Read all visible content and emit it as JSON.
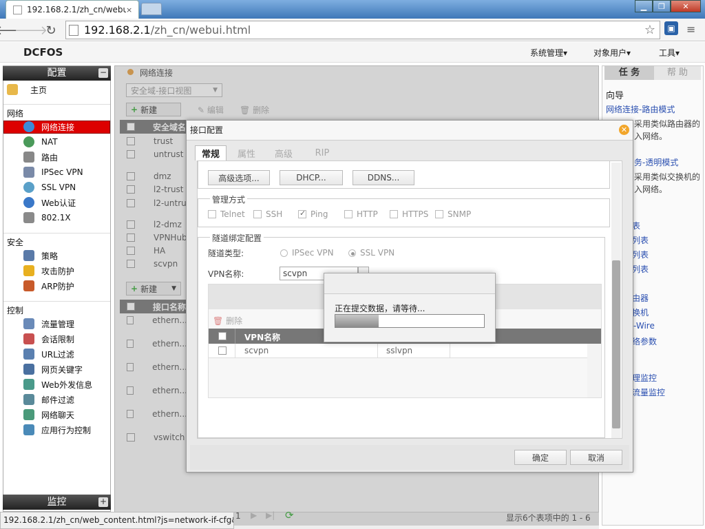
{
  "browser": {
    "tab_title": "192.168.2.1/zh_cn/webu",
    "tab_close": "×",
    "url_host": "192.168.2.1",
    "url_path": "/zh_cn/webui.html",
    "status_url": "192.168.2.1/zh_cn/web_content.html?js=network-if-cfg&..."
  },
  "app": {
    "logo": "DCFOS",
    "top_menu": [
      "系统管理▾",
      "对象用户▾",
      "工具▾"
    ]
  },
  "sidebar": {
    "header": "配置",
    "footer": "监控",
    "toggle_minus": "−",
    "toggle_plus": "+",
    "home": "主页",
    "sections": [
      {
        "title": "网络",
        "items": [
          "网络连接",
          "NAT",
          "路由",
          "IPSec VPN",
          "SSL VPN",
          "Web认证",
          "802.1X"
        ]
      },
      {
        "title": "安全",
        "items": [
          "策略",
          "攻击防护",
          "ARP防护"
        ]
      },
      {
        "title": "控制",
        "items": [
          "流量管理",
          "会话限制",
          "URL过滤",
          "网页关键字",
          "Web外发信息",
          "邮件过滤",
          "网络聊天",
          "应用行为控制"
        ]
      }
    ],
    "selected": "网络连接"
  },
  "main": {
    "breadcrumb": "网络连接",
    "view_select": "安全域-接口视图",
    "new_label": "新建",
    "edit_label": "编辑",
    "delete_label": "删除",
    "zone_header": "安全域名",
    "zones": [
      "trust",
      "untrust",
      "dmz",
      "l2-trust",
      "l2-untru",
      "l2-dmz",
      "VPNHub",
      "HA",
      "scvpn"
    ],
    "iface_header": "接口名称",
    "ifaces": [
      "ethern...",
      "ethern...",
      "ethern...",
      "ethern...",
      "ethern...",
      "vswitch"
    ],
    "pager_page": "1",
    "pager_summary": "显示6个表项中的 1 - 6"
  },
  "right": {
    "tab_task": "任 务",
    "tab_help": "帮 助",
    "guide_title": "向导",
    "lines": [
      {
        "text": "网络连接-路由模式",
        "link": true
      },
      {
        "text": "采用类似路由器的",
        "link": false
      },
      {
        "text": "入网络。",
        "link": false
      },
      {
        "text": "务-透明模式",
        "link": true
      },
      {
        "text": "采用类似交换机的",
        "link": false
      },
      {
        "text": "入网络。",
        "link": false
      },
      {
        "text": "表",
        "link": true
      },
      {
        "text": "列表",
        "link": true
      },
      {
        "text": "列表",
        "link": true
      },
      {
        "text": "列表",
        "link": true
      },
      {
        "text": "由器",
        "link": true
      },
      {
        "text": "换机",
        "link": true
      },
      {
        "text": "-Wire",
        "link": true
      },
      {
        "text": "络参数",
        "link": true
      },
      {
        "text": "理监控",
        "link": true
      },
      {
        "text": "流量监控",
        "link": true
      }
    ]
  },
  "dialog": {
    "title": "接口配置",
    "close_icon": "✕",
    "tabs": [
      "常规",
      "属性",
      "高级",
      "RIP"
    ],
    "buttons_row": [
      "高级选项...",
      "DHCP...",
      "DDNS..."
    ],
    "mgmt_legend": "管理方式",
    "mgmt": [
      {
        "label": "Telnet",
        "checked": false
      },
      {
        "label": "SSH",
        "checked": false
      },
      {
        "label": "Ping",
        "checked": true
      },
      {
        "label": "HTTP",
        "checked": false
      },
      {
        "label": "HTTPS",
        "checked": false
      },
      {
        "label": "SNMP",
        "checked": false
      }
    ],
    "tunnel_legend": "隧道绑定配置",
    "tunnel_type_label": "隧道类型:",
    "tunnel_types": [
      {
        "label": "IPSec VPN",
        "checked": false
      },
      {
        "label": "SSL VPN",
        "checked": true
      }
    ],
    "vpn_name_label": "VPN名称:",
    "vpn_name_value": "scvpn",
    "inner_delete": "删除",
    "vpn_table_header": "VPN名称",
    "vpn_row": [
      "scvpn",
      "sslvpn"
    ],
    "ok": "确定",
    "cancel": "取消"
  },
  "progress": {
    "message": "正在提交数据，请等待...",
    "fraction": 0.29
  },
  "colors": {
    "selected_bg": "#dd0000",
    "link": "#2a4fb0",
    "header_dark": "#333333"
  }
}
